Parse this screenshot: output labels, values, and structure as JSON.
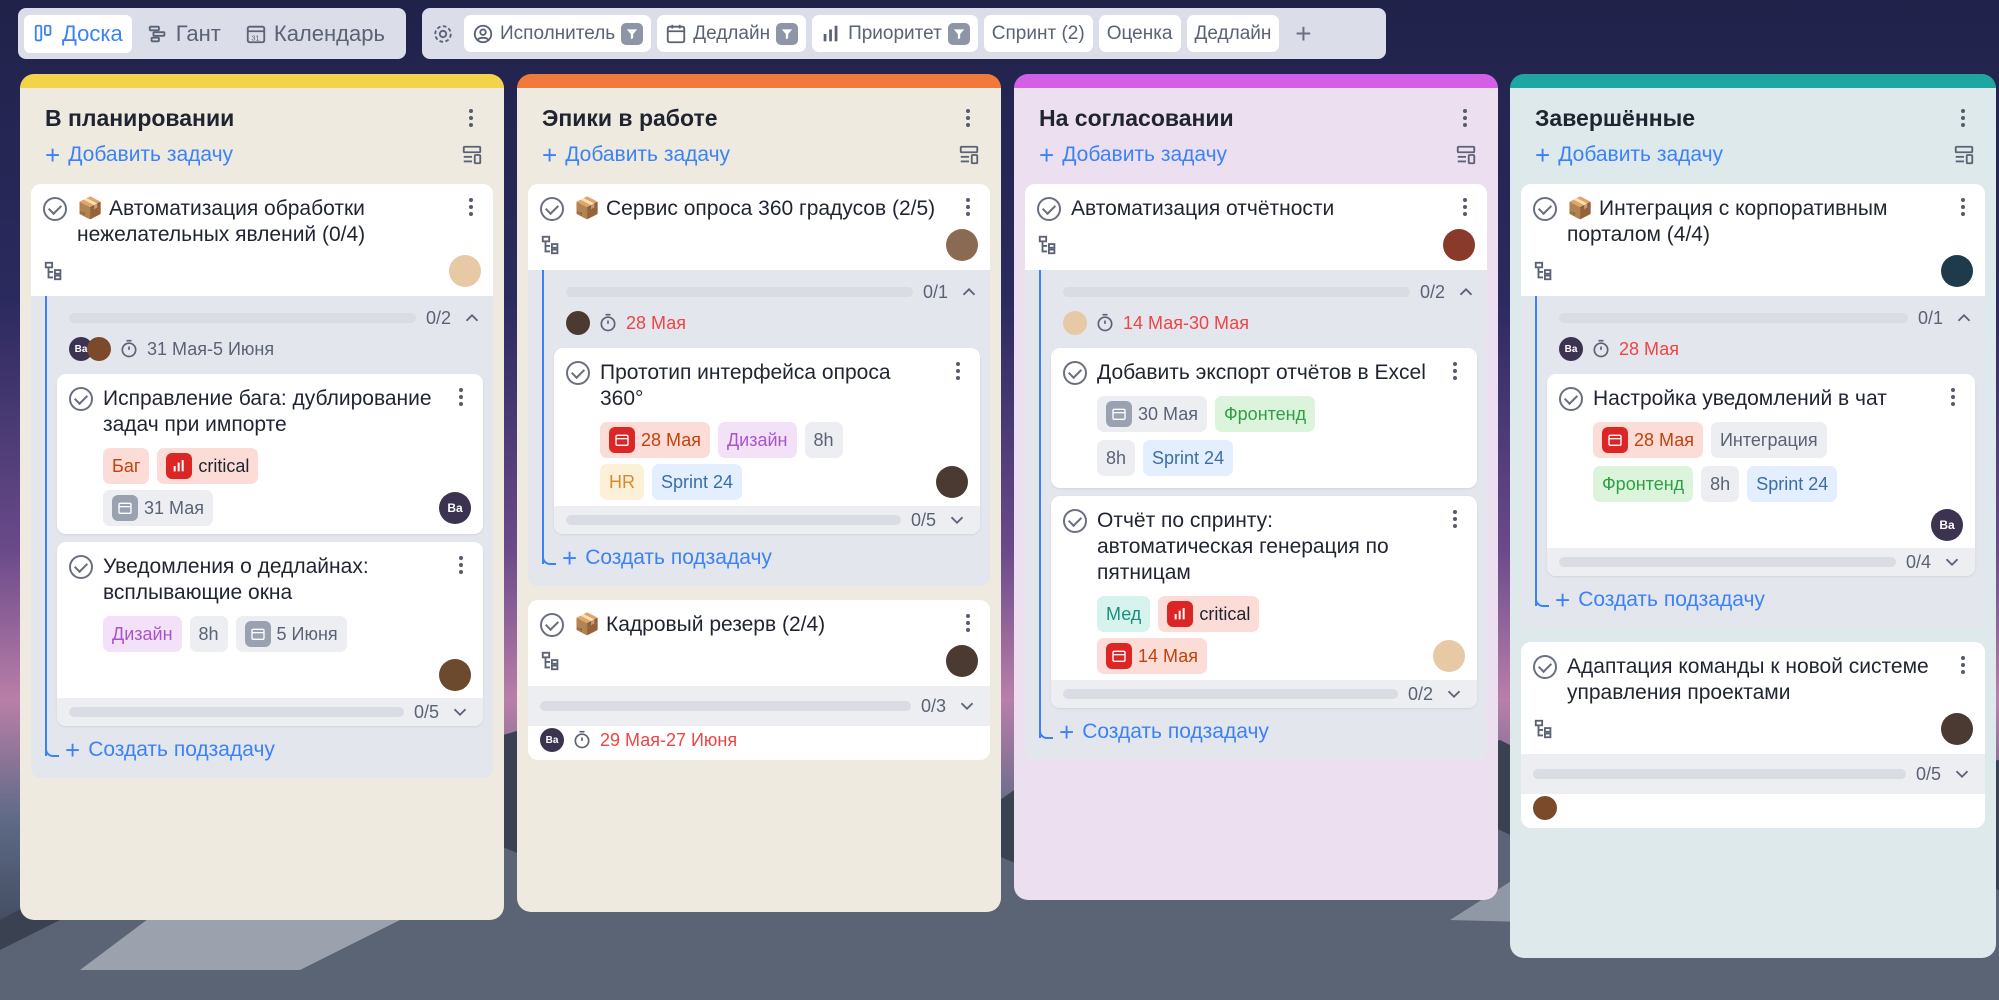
{
  "toolbar": {
    "views": [
      {
        "label": "Доска",
        "icon": "board-icon",
        "active": true
      },
      {
        "label": "Гант",
        "icon": "gantt-icon",
        "active": false
      },
      {
        "label": "Календарь",
        "icon": "calendar-icon",
        "active": false
      }
    ],
    "filters": [
      {
        "label": "Исполнитель",
        "icon": "user-circle-icon"
      },
      {
        "label": "Дедлайн",
        "icon": "calendar-icon"
      },
      {
        "label": "Приоритет",
        "icon": "bars-icon"
      }
    ],
    "plain": [
      "Спринт (2)",
      "Оценка",
      "Дедлайн"
    ]
  },
  "colors": {
    "accent": "#3b82f6",
    "red": "#ef4444"
  },
  "columns": [
    {
      "title": "В планировании",
      "color": "#f3d34a",
      "add_label": "Добавить задачу",
      "epic": {
        "title": "Автоматизация обработки нежелательных явлений (0/4)",
        "progress": "0/2",
        "date": "31 Мая-5 Июня",
        "subtasks": [
          {
            "title": "Исправление бага: дублирование задач при импорте",
            "tag1": "Баг",
            "tag2": "critical",
            "date": "31 Мая"
          },
          {
            "title": "Уведомления о дедлайнах: всплывающие окна",
            "tag1": "Дизайн",
            "tag2": "8h",
            "date": "5 Июня",
            "progress": "0/5"
          }
        ],
        "create_label": "Создать подзадачу"
      }
    },
    {
      "title": "Эпики в работе",
      "color": "#f07a3c",
      "add_label": "Добавить задачу",
      "epic": {
        "title": "Сервис опроса 360 градусов (2/5)",
        "progress": "0/1",
        "date": "28 Мая",
        "subtasks": [
          {
            "title": "Прототип интерфейса опроса 360°",
            "date": "28 Мая",
            "tag1": "Дизайн",
            "tag2": "8h",
            "tag3": "HR",
            "tag4": "Sprint 24",
            "progress": "0/5"
          }
        ],
        "create_label": "Создать подзадачу"
      },
      "epic2": {
        "title": "Кадровый резерв (2/4)",
        "progress": "0/3",
        "date": "29 Мая-27 Июня",
        "av": "Ba"
      }
    },
    {
      "title": "На согласовании",
      "color": "#d260e6",
      "add_label": "Добавить задачу",
      "epic": {
        "title": "Автоматизация отчётности",
        "progress": "0/2",
        "date": "14 Мая-30 Мая",
        "subtasks": [
          {
            "title": "Добавить экспорт отчётов в Excel",
            "date": "30 Мая",
            "tag1": "Фронтенд",
            "tag2": "8h",
            "tag3": "Sprint 24"
          },
          {
            "title": "Отчёт по спринту: автоматическая генерация по пятницам",
            "tag1": "Мед",
            "tag2": "critical",
            "date": "14 Мая",
            "progress": "0/2"
          }
        ],
        "create_label": "Создать подзадачу"
      }
    },
    {
      "title": "Завершённые",
      "color": "#1fa6a0",
      "add_label": "Добавить задачу",
      "epic": {
        "title": "Интеграция с корпоративным порталом (4/4)",
        "progress": "0/1",
        "date": "28 Мая",
        "av": "Ba",
        "subtasks": [
          {
            "title": "Настройка уведомлений в чат",
            "date": "28 Мая",
            "tag1": "Интеграция",
            "tag2": "Фронтенд",
            "tag3": "8h",
            "tag4": "Sprint 24",
            "av": "Ba",
            "progress": "0/4"
          }
        ],
        "create_label": "Создать подзадачу"
      },
      "epic2": {
        "title": "Адаптация команды к новой системе управления проектами",
        "progress": "0/5"
      }
    }
  ]
}
